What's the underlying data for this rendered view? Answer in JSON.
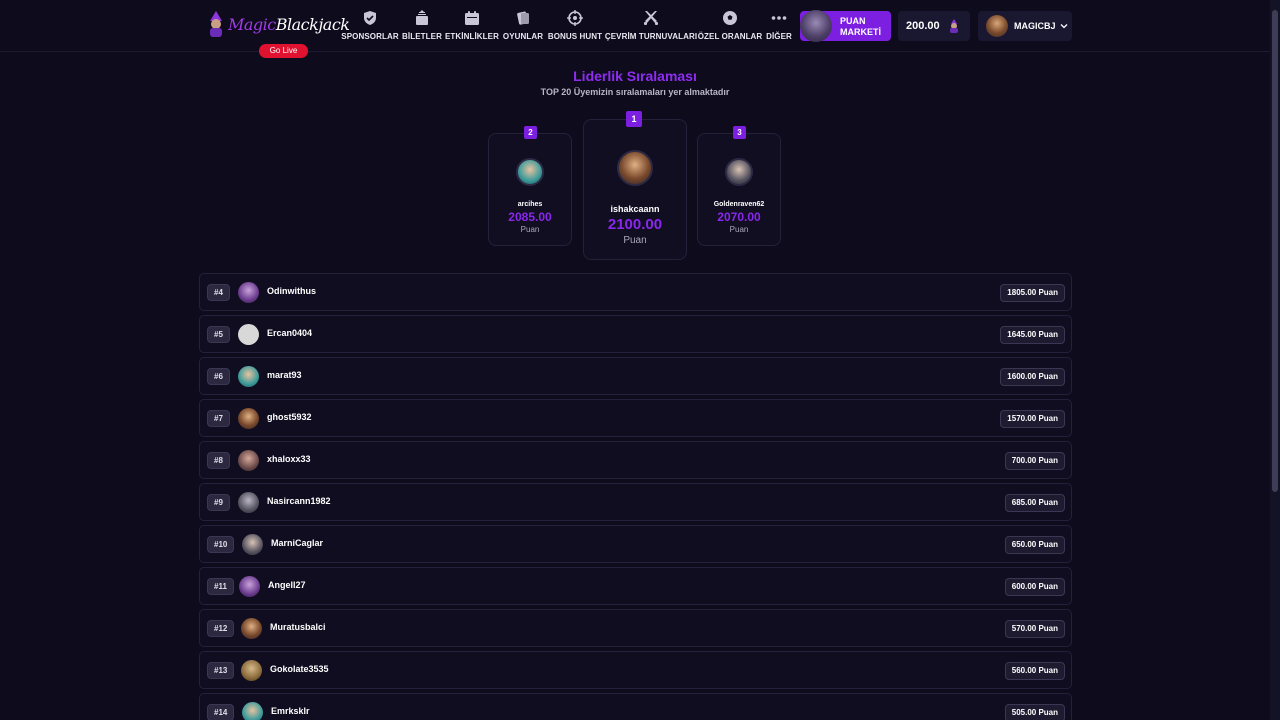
{
  "header": {
    "logo": {
      "magic": "Magic",
      "blackjack": "Blackjack"
    },
    "go_live": "Go Live",
    "nav": [
      {
        "label": "SPONSORLAR",
        "icon": "shield-check-icon"
      },
      {
        "label": "BİLETLER",
        "icon": "ticket-stack-icon"
      },
      {
        "label": "ETKİNLİKLER",
        "icon": "calendar-icon"
      },
      {
        "label": "OYUNLAR",
        "icon": "cards-icon"
      },
      {
        "label": "BONUS HUNT",
        "icon": "crosshair-icon"
      },
      {
        "label": "ÇEVRİM TURNUVALARI",
        "icon": "crossed-swords-icon"
      },
      {
        "label": "ÖZEL ORANLAR",
        "icon": "soccer-ball-icon"
      },
      {
        "label": "DİĞER",
        "icon": "more-dots-icon"
      }
    ],
    "market": {
      "line1": "PUAN",
      "line2": "MARKETİ"
    },
    "balance": "200.00",
    "user": "MAGICBJ"
  },
  "leaderboard": {
    "title": "Liderlik Sıralaması",
    "subtitle": "TOP 20 Üyemizin sıralamaları yer almaktadır",
    "podium": {
      "first": {
        "rank": "1",
        "name": "ishakcaann",
        "points": "2100.00",
        "unit": "Puan"
      },
      "second": {
        "rank": "2",
        "name": "arcihes",
        "points": "2085.00",
        "unit": "Puan"
      },
      "third": {
        "rank": "3",
        "name": "Goldenraven62",
        "points": "2070.00",
        "unit": "Puan"
      }
    },
    "rows": [
      {
        "rank": "#4",
        "name": "Odinwithus",
        "points": "1805.00 Puan"
      },
      {
        "rank": "#5",
        "name": "Ercan0404",
        "points": "1645.00 Puan"
      },
      {
        "rank": "#6",
        "name": "marat93",
        "points": "1600.00 Puan"
      },
      {
        "rank": "#7",
        "name": "ghost5932",
        "points": "1570.00 Puan"
      },
      {
        "rank": "#8",
        "name": "xhaloxx33",
        "points": "700.00 Puan"
      },
      {
        "rank": "#9",
        "name": "Nasircann1982",
        "points": "685.00 Puan"
      },
      {
        "rank": "#10",
        "name": "MarniCaglar",
        "points": "650.00 Puan"
      },
      {
        "rank": "#11",
        "name": "Angell27",
        "points": "600.00 Puan"
      },
      {
        "rank": "#12",
        "name": "Muratusbalci",
        "points": "570.00 Puan"
      },
      {
        "rank": "#13",
        "name": "Gokolate3535",
        "points": "560.00 Puan"
      },
      {
        "rank": "#14",
        "name": "Emrksklr",
        "points": "505.00 Puan"
      }
    ]
  },
  "colors": {
    "accent": "#7c1fe0",
    "accent_text": "#8a27ee",
    "background": "#0d0b1c",
    "live": "#e1122f"
  }
}
